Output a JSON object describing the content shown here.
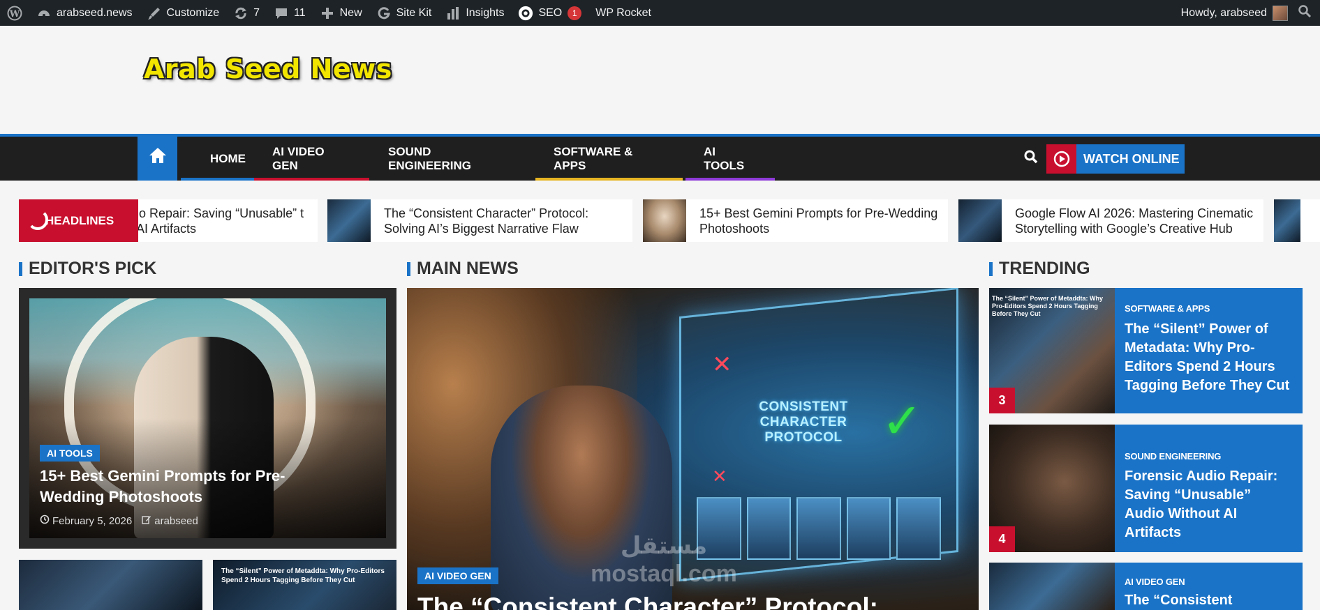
{
  "admin_bar": {
    "site": "arabseed.news",
    "customize": "Customize",
    "updates": "7",
    "comments": "11",
    "new": "New",
    "site_kit": "Site Kit",
    "insights": "Insights",
    "seo": "SEO",
    "seo_count": "1",
    "wp_rocket": "WP Rocket",
    "howdy": "Howdy, arabseed"
  },
  "header": {
    "logo": "Arab Seed News"
  },
  "nav": {
    "items": [
      {
        "label": "HOME",
        "color": "#1a73c7"
      },
      {
        "label": "AI VIDEO GEN",
        "color": "#c8102e"
      },
      {
        "label": "SOUND ENGINEERING",
        "color": ""
      },
      {
        "label": "SOFTWARE & APPS",
        "color": "#e6b422"
      },
      {
        "label": "AI TOOLS",
        "color": "#8e3ad8"
      }
    ],
    "watch": "WATCH ONLINE"
  },
  "ticker": {
    "label": "HEADLINES",
    "items": [
      "io Repair: Saving “Unusable” t AI Artifacts",
      "The “Consistent Character” Protocol: Solving AI’s Biggest Narrative Flaw",
      "15+ Best Gemini Prompts for Pre-Wedding Photoshoots",
      "Google Flow AI 2026: Mastering Cinematic Storytelling with Google’s Creative Hub"
    ]
  },
  "sections": {
    "editors_pick": "EDITOR'S PICK",
    "main_news": "MAIN NEWS",
    "trending": "TRENDING"
  },
  "editors_pick": {
    "category": "AI TOOLS",
    "title": "15+ Best Gemini Prompts for Pre-Wedding Photoshoots",
    "date": "February 5, 2026",
    "author": "arabseed",
    "sub2_caption": "The “Silent” Power of Metaddta: Why Pro-Editors Spend 2 Hours Tagging Before They Cut"
  },
  "main_news": {
    "category": "AI VIDEO GEN",
    "title": "The “Consistent Character” Protocol:",
    "holo_text": "CONSISTENT CHARACTER PROTOCOL",
    "watermark": "مستقل mostaql.com"
  },
  "trending": [
    {
      "num": "3",
      "category": "SOFTWARE & APPS",
      "title": "The “Silent” Power of Metadata: Why Pro-Editors Spend 2 Hours Tagging Before They Cut",
      "thumb_caption": "The “Silent” Power of Metaddta: Why Pro-Editors Spend 2 Hours Tagging Before They Cut"
    },
    {
      "num": "4",
      "category": "SOUND ENGINEERING",
      "title": "Forensic Audio Repair: Saving “Unusable” Audio Without AI Artifacts"
    },
    {
      "num": "",
      "category": "AI VIDEO GEN",
      "title": "The “Consistent"
    }
  ]
}
